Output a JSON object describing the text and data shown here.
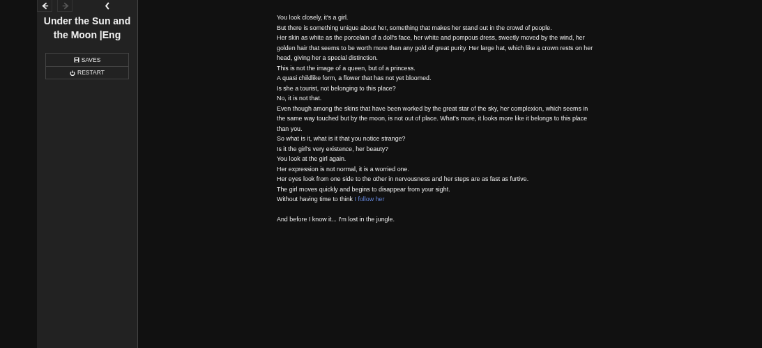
{
  "sidebar": {
    "history": [
      {
        "kind": "back",
        "disabled": false
      },
      {
        "kind": "forward",
        "disabled": true
      }
    ],
    "title": "Under the Sun and the Moon |Eng",
    "menu": [
      {
        "kind": "saves",
        "label": "SAVES"
      },
      {
        "kind": "restart",
        "label": "RESTART"
      }
    ]
  },
  "passage": {
    "paragraphs": [
      [
        {
          "text": "You look closely, it's a girl."
        },
        {
          "text": "But there is something unique about her, something that makes her stand out in the crowd of people."
        },
        {
          "text": "Her skin as white as the porcelain of a doll's face, her white and pompous dress, sweetly moved by the wind, her golden hair that seems to be worth more than any gold of great purity. Her large hat, which like a crown rests on her head, giving her a special distinction."
        },
        {
          "text": "This is not the image of a queen, but of a princess."
        },
        {
          "text": "A quasi childlike form, a flower that has not yet bloomed."
        },
        {
          "text": "Is she a tourist, not belonging to this place?"
        },
        {
          "text": "No, it is not that."
        },
        {
          "text": "Even though among the skins that have been worked by the great star of the sky, her complexion, which seems in the same way touched but by the moon, is not out of place. What's more, it looks more like it belongs to this place than you."
        },
        {
          "text": "So what is it, what is it that you notice strange?"
        },
        {
          "text": "Is it the girl's very existence, her beauty?"
        },
        {
          "text": "You look at the girl again."
        },
        {
          "text": "Her expression is not normal, it is a worried one."
        },
        {
          "text": "Her eyes look from one side to the other in nervousness and her steps are as fast as furtive."
        },
        {
          "text": "The girl moves quickly and begins to disappear from your sight."
        },
        {
          "text": "Without having time to think ",
          "link": "I follow her"
        }
      ],
      [
        {
          "text": "And before I know it... I'm lost in the jungle."
        }
      ]
    ]
  }
}
